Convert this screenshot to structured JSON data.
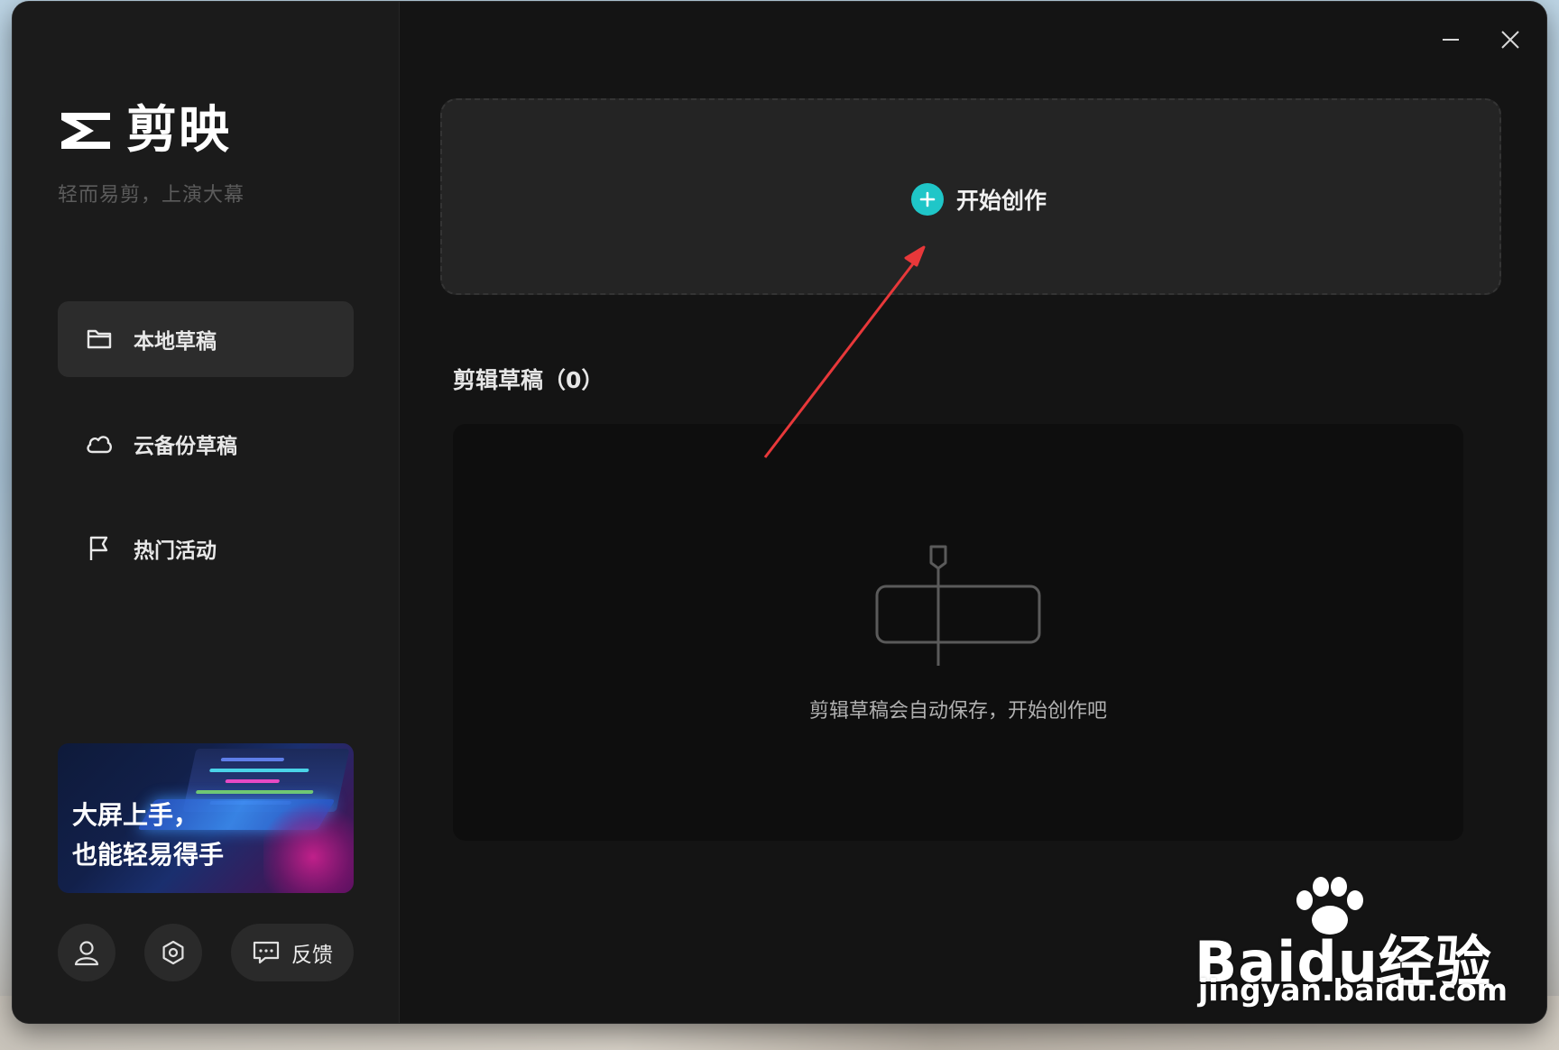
{
  "app": {
    "logo_text": "剪映",
    "slogan": "轻而易剪，上演大幕"
  },
  "sidebar": {
    "items": [
      {
        "label": "本地草稿",
        "icon": "folder-icon",
        "active": true
      },
      {
        "label": "云备份草稿",
        "icon": "cloud-icon",
        "active": false
      },
      {
        "label": "热门活动",
        "icon": "flag-icon",
        "active": false
      }
    ],
    "promo": {
      "text": "大屏上手，\n也能轻易得手"
    },
    "footer": {
      "account_icon": "user-icon",
      "settings_icon": "settings-icon",
      "feedback_label": "反馈",
      "feedback_icon": "chat-icon"
    }
  },
  "window_controls": {
    "minimize_icon": "minimize-icon",
    "close_icon": "close-icon"
  },
  "main": {
    "create_label": "开始创作",
    "section_title": "剪辑草稿（0）",
    "empty_text": "剪辑草稿会自动保存，开始创作吧"
  },
  "watermark": {
    "brand": "Bai",
    "brand_tail": "du经验",
    "url": "jingyan.baidu.com"
  },
  "colors": {
    "accent": "#1fc6c8",
    "annotation_arrow": "#e8383a",
    "window_bg": "#141414",
    "sidebar_bg": "#1b1b1b"
  }
}
